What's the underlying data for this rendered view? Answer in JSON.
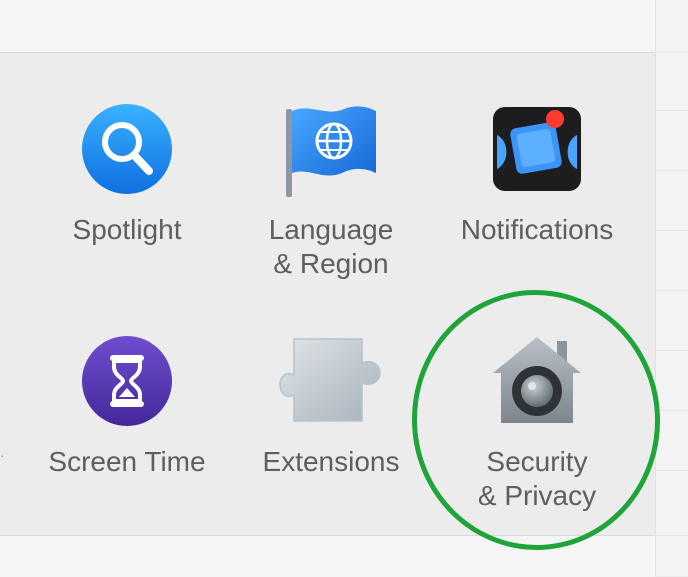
{
  "prefs": [
    {
      "id": "spotlight",
      "label": "Spotlight",
      "icon": "magnifier-icon"
    },
    {
      "id": "language-region",
      "label": "Language\n& Region",
      "icon": "globe-flag-icon"
    },
    {
      "id": "notifications",
      "label": "Notifications",
      "icon": "notifications-icon"
    },
    {
      "id": "screen-time",
      "label": "Screen Time",
      "icon": "hourglass-icon"
    },
    {
      "id": "extensions",
      "label": "Extensions",
      "icon": "puzzle-piece-icon"
    },
    {
      "id": "security-privacy",
      "label": "Security\n& Privacy",
      "icon": "house-lock-icon"
    }
  ],
  "highlight": {
    "target": "security-privacy",
    "color": "#1fa43a"
  },
  "colors": {
    "spotlight_blue": "#1d8ff5",
    "flag_blue": "#2d8cf0",
    "notification_red": "#ff3b30",
    "screen_time_purple": "#5a3ab6"
  }
}
